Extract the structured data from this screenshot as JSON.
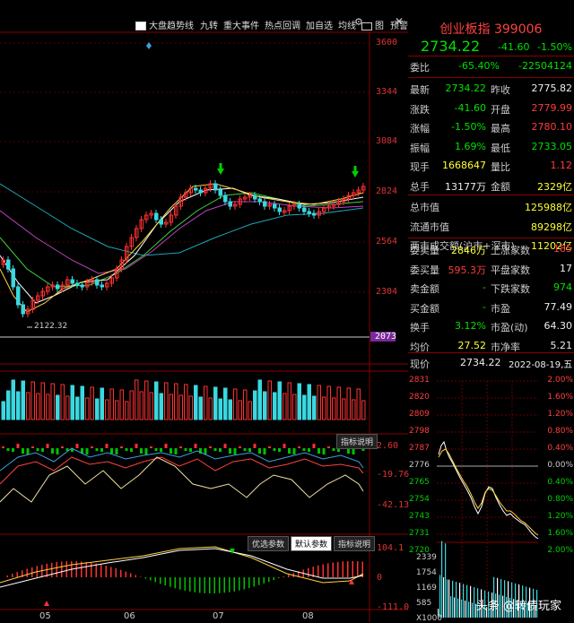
{
  "toolbar": {
    "items": [
      "大盘趋势线",
      "九转",
      "重大事件",
      "热点回调",
      "加自选",
      "均线",
      "图",
      "预警"
    ]
  },
  "axis": {
    "price_ticks": [
      "3600",
      "3344",
      "3084",
      "2824",
      "2564",
      "2304",
      "2073"
    ],
    "low_label": "2122.32",
    "vol_label": "",
    "ind1_ticks": [
      "2.60",
      "-19.76",
      "-42.13"
    ],
    "ind2_ticks": [
      "104.1",
      "0",
      "-111.0"
    ],
    "months": [
      "05",
      "06",
      "07",
      "08"
    ]
  },
  "buttons": {
    "explain1": "指标说明",
    "optimize": "优选参数",
    "default": "默认参数",
    "explain2": "指标说明"
  },
  "quote": {
    "title": "创业板指 399006",
    "price": "2734.22",
    "change": "-41.60",
    "pct": "-1.50%",
    "weibi_label": "委比",
    "weibi_pct": "-65.40%",
    "weibi_val": "-22504124",
    "rows1": [
      {
        "l": "最新",
        "v": "2734.22",
        "vc": "green",
        "l2": "昨收",
        "v2": "2775.82",
        "v2c": "white"
      },
      {
        "l": "涨跌",
        "v": "-41.60",
        "vc": "green",
        "l2": "开盘",
        "v2": "2779.99",
        "v2c": "red"
      },
      {
        "l": "涨幅",
        "v": "-1.50%",
        "vc": "green",
        "l2": "最高",
        "v2": "2780.10",
        "v2c": "red"
      },
      {
        "l": "振幅",
        "v": "1.69%",
        "vc": "green",
        "l2": "最低",
        "v2": "2733.05",
        "v2c": "green"
      },
      {
        "l": "现手",
        "v": "1668647",
        "vc": "yellow",
        "l2": "量比",
        "v2": "1.12",
        "v2c": "red"
      },
      {
        "l": "总手",
        "v": "13177万",
        "vc": "white",
        "l2": "金额",
        "v2": "2329亿",
        "v2c": "yellow"
      }
    ],
    "rows2": [
      {
        "l": "总市值",
        "v": "125988亿",
        "vc": "yellow"
      },
      {
        "l": "流通市值",
        "v": "89298亿",
        "vc": "yellow"
      },
      {
        "l": "两市成交额(沪市+深市)",
        "v": "11202亿",
        "vc": "yellow"
      }
    ],
    "rows3": [
      {
        "l": "委卖量",
        "v": "2846万",
        "vc": "yellow",
        "l2": "上涨家数",
        "v2": "185",
        "v2c": "red"
      },
      {
        "l": "委买量",
        "v": "595.3万",
        "vc": "red",
        "l2": "平盘家数",
        "v2": "17",
        "v2c": "white"
      },
      {
        "l": "卖金额",
        "v": "-",
        "vc": "green",
        "l2": "下跌家数",
        "v2": "974",
        "v2c": "green"
      },
      {
        "l": "买金额",
        "v": "-",
        "vc": "green",
        "l2": "市盈",
        "v2": "77.49",
        "v2c": "white"
      },
      {
        "l": "换手",
        "v": "3.12%",
        "vc": "green",
        "l2": "市盈(动)",
        "v2": "64.30",
        "v2c": "white"
      },
      {
        "l": "均价",
        "v": "27.52",
        "vc": "yellow",
        "l2": "市净率",
        "v2": "5.21",
        "v2c": "white"
      }
    ],
    "now_label": "现价",
    "now_price": "2734.22",
    "date": "2022-08-19,五"
  },
  "intraday": {
    "left_ticks": [
      "2831",
      "2820",
      "2809",
      "2798",
      "2787",
      "2776",
      "2765",
      "2754",
      "2743",
      "2731",
      "2720"
    ],
    "right_ticks": [
      "2.00%",
      "1.60%",
      "1.20%",
      "0.80%",
      "0.40%",
      "0.00%",
      "0.40%",
      "0.80%",
      "1.20%",
      "1.60%",
      "2.00%"
    ],
    "vol_ticks": [
      "2339",
      "1754",
      "1169",
      "585",
      "X1000"
    ]
  },
  "watermark": "头条 @转债玩家"
}
